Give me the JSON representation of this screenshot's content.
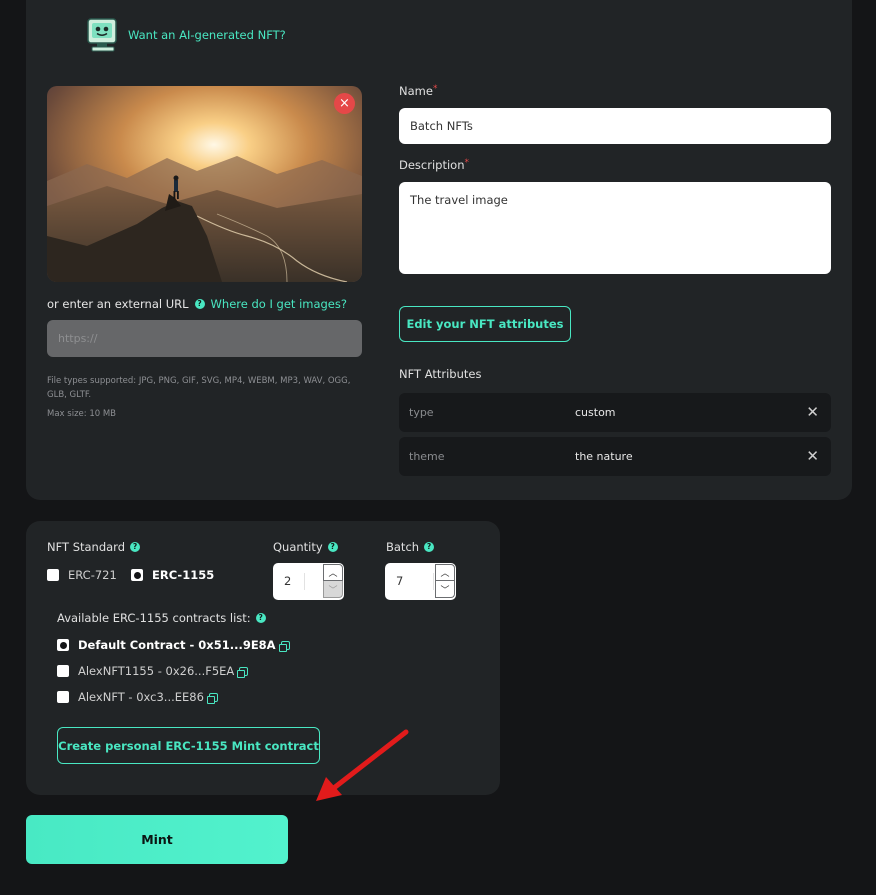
{
  "ai_prompt": {
    "label": "Want an AI-generated NFT?",
    "icon": "robot-icon"
  },
  "media": {
    "preview_alt": "mountain sunrise travel image",
    "remove_icon": "close-icon",
    "remove_symbol": "×",
    "external_url_label": "or enter an external URL",
    "help_link": "Where do I get images?",
    "url_placeholder": "https://",
    "file_types": "File types supported: JPG, PNG, GIF, SVG, MP4, WEBM, MP3, WAV, OGG, GLB, GLTF.",
    "max_size": "Max size: 10 MB"
  },
  "form": {
    "name_label": "Name",
    "name_value": "Batch NFTs",
    "description_label": "Description",
    "description_value": "The travel image",
    "required_mark": "*",
    "edit_attributes_button": "Edit your NFT attributes",
    "attributes_label": "NFT Attributes",
    "attributes": [
      {
        "key": "type",
        "value": "custom"
      },
      {
        "key": "theme",
        "value": "the nature"
      }
    ],
    "remove_symbol": "✕"
  },
  "mint_settings": {
    "standard_label": "NFT Standard",
    "standards": [
      {
        "label": "ERC-721",
        "selected": false
      },
      {
        "label": "ERC-1155",
        "selected": true
      }
    ],
    "quantity_label": "Quantity",
    "quantity_value": "2",
    "batch_label": "Batch",
    "batch_value": "7",
    "up_symbol": "︿",
    "down_symbol": "﹀",
    "help_symbol": "?",
    "contracts_label": "Available ERC-1155 contracts list:",
    "contracts": [
      {
        "label": "Default Contract - 0x51...9E8A",
        "selected": true
      },
      {
        "label": "AlexNFT1155 - 0x26...F5EA",
        "selected": false
      },
      {
        "label": "AlexNFT - 0xc3...EE86",
        "selected": false
      }
    ],
    "create_contract_button": "Create personal ERC-1155 Mint contract"
  },
  "mint_button": "Mint",
  "colors": {
    "accent": "#49e7c2",
    "panel": "#212426",
    "background": "#141517",
    "required": "#e54848",
    "arrow": "#e21b1b"
  }
}
